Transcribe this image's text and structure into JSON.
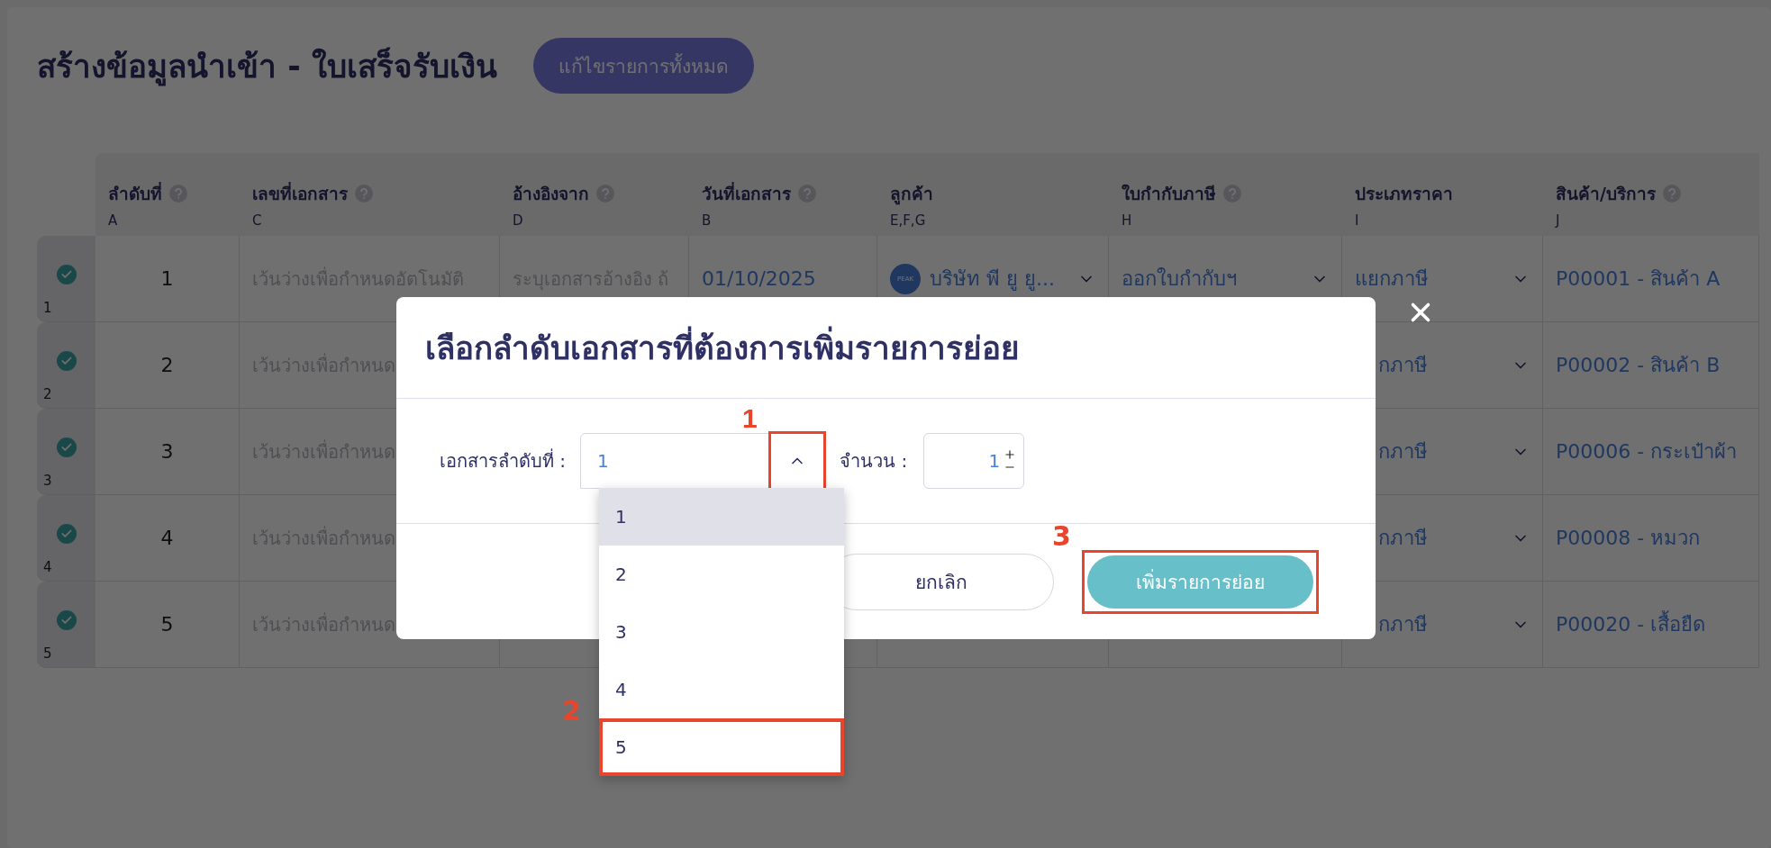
{
  "page": {
    "title": "สร้างข้อมูลนำเข้า - ใบเสร็จรับเงิน",
    "edit_all_button": "แก้ไขรายการทั้งหมด"
  },
  "table": {
    "columns": [
      {
        "label": "ลำดับที่",
        "letter": "A",
        "help": true
      },
      {
        "label": "เลขที่เอกสาร",
        "letter": "C",
        "help": true
      },
      {
        "label": "อ้างอิงจาก",
        "letter": "D",
        "help": true
      },
      {
        "label": "วันที่เอกสาร",
        "letter": "B",
        "help": true
      },
      {
        "label": "ลูกค้า",
        "letter": "E,F,G",
        "help": false
      },
      {
        "label": "ใบกำกับภาษี",
        "letter": "H",
        "help": true
      },
      {
        "label": "ประเภทราคา",
        "letter": "I",
        "help": false
      },
      {
        "label": "สินค้า/บริการ",
        "letter": "J",
        "help": true
      }
    ],
    "rows": [
      {
        "index": "1",
        "checked": true,
        "under_dialog": false,
        "number": "1",
        "doc_no": "เว้นว่างเพื่อกำหนดอัตโนมัติ",
        "reference": "ระบุเอกสารอ้างอิง ถ้",
        "date": "01/10/2025",
        "customer": {
          "logo": "PEAK",
          "name": "บริษัท พี ยู ยู..."
        },
        "tax_invoice": "ออกใบกำกับฯ",
        "price_type": "แยกภาษี",
        "product": "P00001 - สินค้า A"
      },
      {
        "index": "2",
        "checked": true,
        "under_dialog": true,
        "number": "2",
        "doc_no": "เว้นว่างเพื่อกำหนด",
        "price_type": "กภาษี",
        "product": "P00002 - สินค้า B"
      },
      {
        "index": "3",
        "checked": true,
        "under_dialog": true,
        "number": "3",
        "doc_no": "เว้นว่างเพื่อกำหนด",
        "price_type": "กภาษี",
        "product": "P00006 - กระเป๋าผ้า"
      },
      {
        "index": "4",
        "checked": true,
        "under_dialog": true,
        "number": "4",
        "doc_no": "เว้นว่างเพื่อกำหนด",
        "price_type": "กภาษี",
        "product": "P00008 - หมวก"
      },
      {
        "index": "5",
        "checked": true,
        "under_dialog": true,
        "number": "5",
        "doc_no": "เว้นว่างเพื่อกำหนด",
        "price_type": "กภาษี",
        "product": "P00020 - เสื้อยืด"
      }
    ]
  },
  "dialog": {
    "title": "เลือกลำดับเอกสารที่ต้องการเพิ่มรายการย่อย",
    "select": {
      "label": "เอกสารลำดับที่ :",
      "value": "1",
      "expanded": true,
      "highlighted": true,
      "annotation": "1",
      "options": [
        {
          "label": "1",
          "selected": true,
          "highlighted": false
        },
        {
          "label": "2",
          "selected": false,
          "highlighted": false
        },
        {
          "label": "3",
          "selected": false,
          "highlighted": false
        },
        {
          "label": "4",
          "selected": false,
          "highlighted": false
        },
        {
          "label": "5",
          "selected": false,
          "highlighted": true,
          "annotation": "2"
        }
      ]
    },
    "quantity": {
      "label": "จำนวน :",
      "value": "1"
    },
    "cancel_button": "ยกเลิก",
    "confirm_button": {
      "label": "เพิ่มรายการย่อย",
      "highlighted": true,
      "annotation": "3"
    }
  }
}
